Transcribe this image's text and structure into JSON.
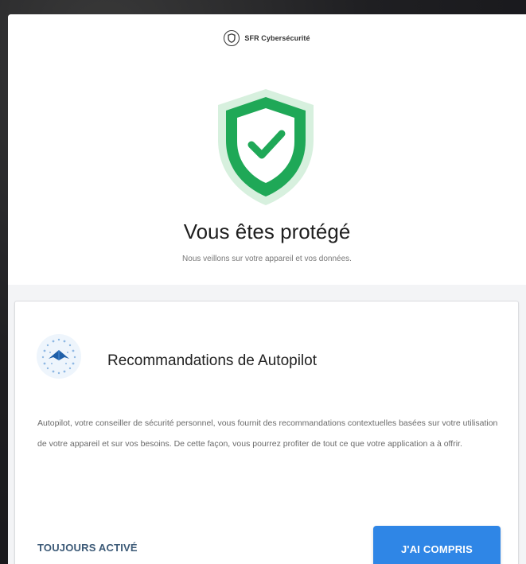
{
  "app": {
    "brand_name": "SFR Cybersécurité"
  },
  "status": {
    "title": "Vous êtes protégé",
    "subtitle": "Nous veillons sur votre appareil et vos données."
  },
  "autopilot_card": {
    "title": "Recommandations de Autopilot",
    "description": "Autopilot, votre conseiller de sécurité personnel, vous fournit des recommandations contextuelles basées sur votre utilisation de votre appareil et sur vos besoins. De cette façon, vous pourrez profiter de tout ce que votre application a à offrir.",
    "always_on_label": "TOUJOURS ACTIVÉ",
    "ok_button_label": "J'AI COMPRIS"
  },
  "colors": {
    "shield_green": "#1fa857",
    "shield_halo": "#d7f0de",
    "button_blue": "#2f86e6",
    "always_on_text": "#3c5a77"
  },
  "icons": {
    "brand": "sfr-shield-logo-icon",
    "status": "shield-check-icon",
    "card": "autopilot-icon"
  }
}
